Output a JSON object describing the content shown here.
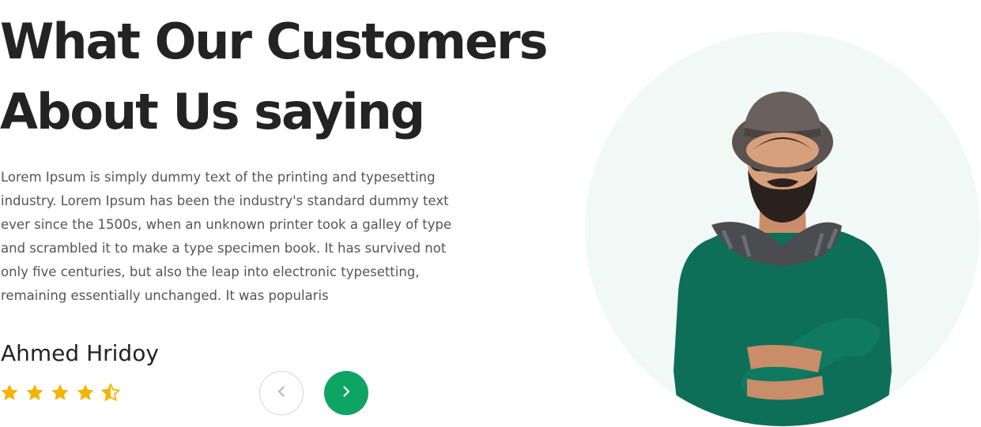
{
  "section": {
    "heading_line1": "What Our Customers",
    "heading_line2": "About Us saying",
    "description": "Lorem Ipsum is simply dummy text of the printing and typesetting industry. Lorem Ipsum has been the industry's standard dummy text ever since the 1500s, when an unknown printer took a galley of type and scrambled it to make a type specimen book. It has survived not only five centuries, but also the leap into electronic typesetting, remaining essentially unchanged. It was popularis"
  },
  "testimonial": {
    "name": "Ahmed Hridoy",
    "rating": 4.5,
    "rating_max": 5
  },
  "navigation": {
    "prev_icon": "chevron-left-icon",
    "next_icon": "chevron-right-icon"
  },
  "colors": {
    "accent": "#0ea464",
    "star": "#f4b400",
    "circle_bg": "#f1f9f6",
    "heading": "#232323",
    "body_text": "#555555"
  }
}
